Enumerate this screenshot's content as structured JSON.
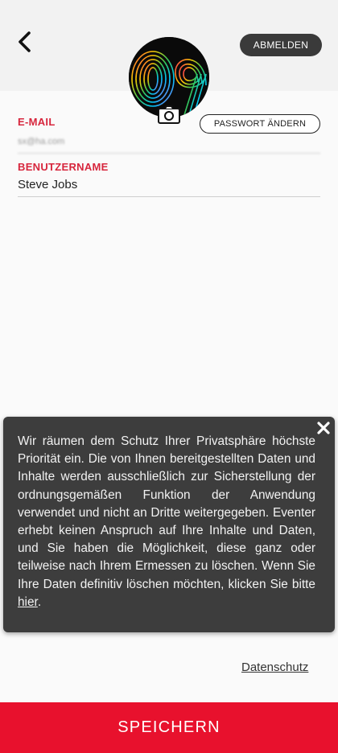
{
  "header": {
    "logout_label": "ABMELDEN"
  },
  "profile": {
    "avatar_icon": "rainbow-09-logo",
    "camera_icon": "camera-icon",
    "password_button_label": "PASSWORT ÄNDERN"
  },
  "fields": {
    "email": {
      "label": "E-MAIL",
      "value": "sx@ha.com"
    },
    "username": {
      "label": "BENUTZERNAME",
      "value": "Steve Jobs"
    }
  },
  "info_popup": {
    "text": "Wir räumen dem Schutz Ihrer Privatsphäre höchste Priorität ein. Die von Ihnen bereitgestellten Daten und Inhalte werden ausschließlich zur Sicherstellung der ordnungsgemäßen Funktion der Anwendung verwendet und nicht an Dritte weitergegeben. Eventer erhebt keinen Anspruch auf Ihre Inhalte und Daten, und Sie haben die Möglichkeit, diese ganz oder teilweise nach Ihrem Ermessen zu löschen. Wenn Sie Ihre Daten definitiv löschen möchten, klicken Sie bitte",
    "link_label": "hier",
    "suffix": "."
  },
  "footer": {
    "privacy_link": "Datenschutz",
    "save_label": "SPEICHERN"
  },
  "colors": {
    "accent": "#e8112d",
    "label_red": "#d7263d",
    "dark_button": "#3a3a3a",
    "popup_bg": "#3d3d3d"
  }
}
